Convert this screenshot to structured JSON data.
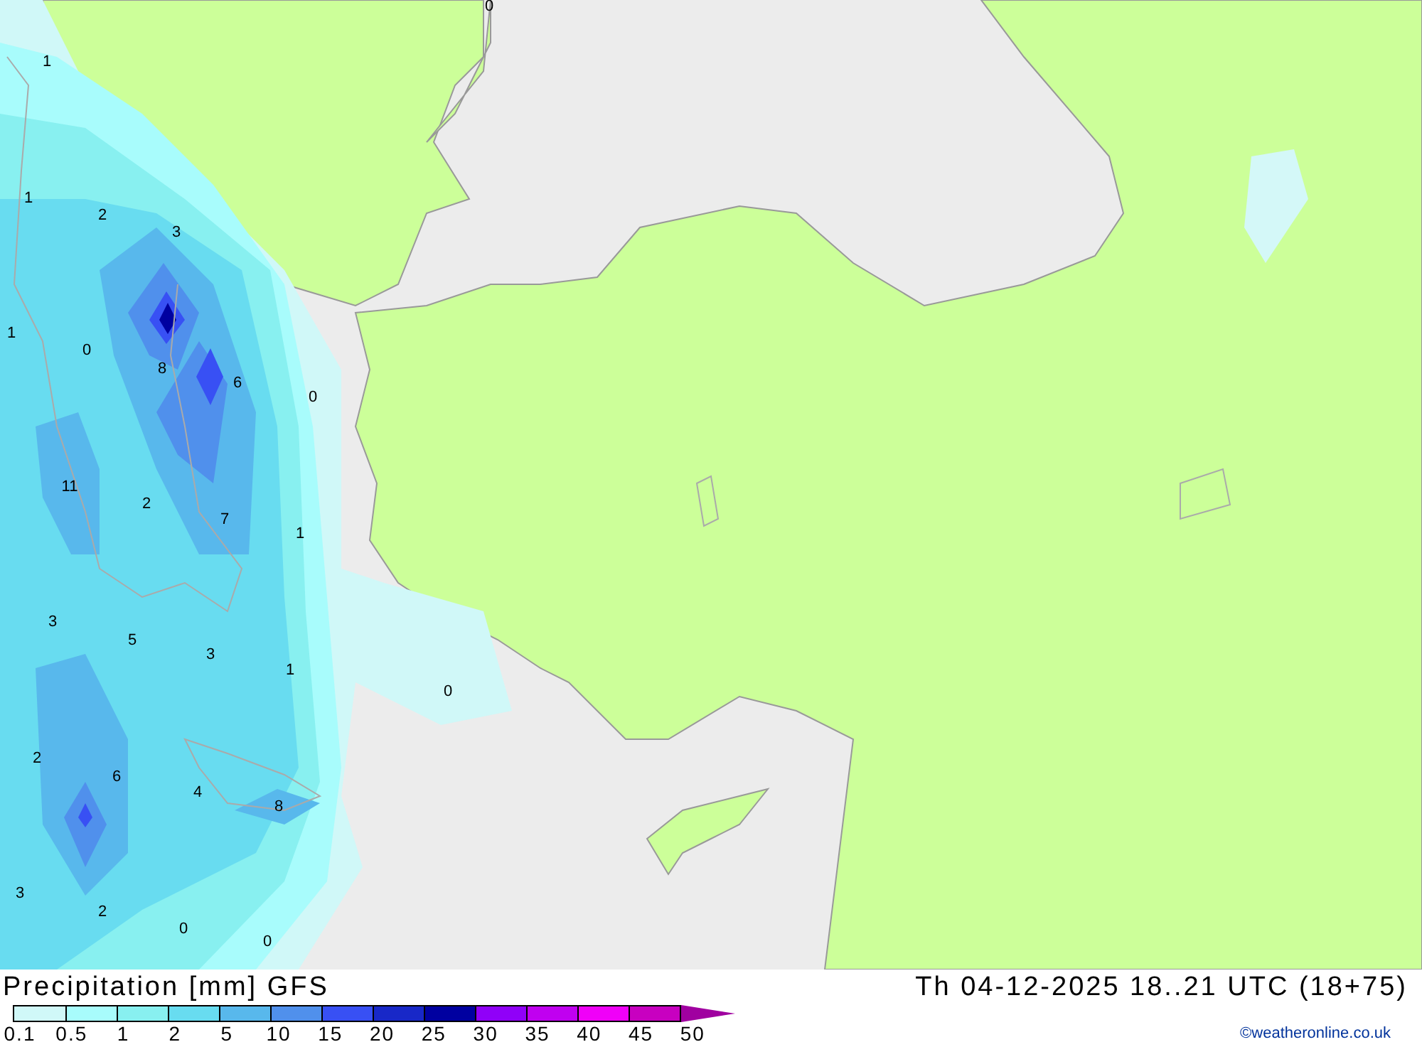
{
  "map": {
    "value_labels": [
      "0",
      "1",
      "1",
      "2",
      "3",
      "1",
      "0",
      "8",
      "6",
      "0",
      "11",
      "2",
      "7",
      "1",
      "3",
      "5",
      "3",
      "1",
      "0",
      "2",
      "6",
      "4",
      "8",
      "3",
      "2",
      "0",
      "0"
    ]
  },
  "legend": {
    "title": "Precipitation [mm] GFS",
    "valid_time": "Th 04-12-2025 18..21 UTC (18+75)",
    "bins": [
      {
        "color": "#d0f8f8"
      },
      {
        "color": "#a8fcfc"
      },
      {
        "color": "#88f0f0"
      },
      {
        "color": "#68dcf0"
      },
      {
        "color": "#58b8ec"
      },
      {
        "color": "#5090ec"
      },
      {
        "color": "#3850f4"
      },
      {
        "color": "#1828c8"
      },
      {
        "color": "#0000a0"
      },
      {
        "color": "#9000f8"
      },
      {
        "color": "#c000f0"
      },
      {
        "color": "#f000f8"
      },
      {
        "color": "#c800c0"
      },
      {
        "kind": "overflow-arrow",
        "color": "#a000a0"
      }
    ],
    "ticks": [
      "0.1",
      "0.5",
      "1",
      "2",
      "5",
      "10",
      "15",
      "20",
      "25",
      "30",
      "35",
      "40",
      "45",
      "50"
    ],
    "credit": "©weatheronline.co.uk"
  }
}
